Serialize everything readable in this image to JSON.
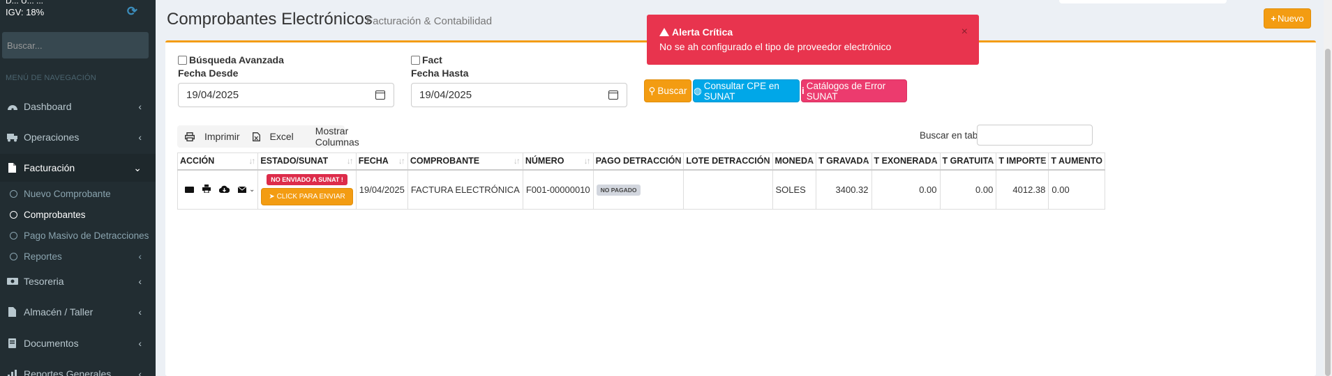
{
  "sidebar": {
    "top_partial": "D... U... ...",
    "igv": "IGV: 18%",
    "search_placeholder": "Buscar...",
    "nav_header": "MENÚ DE NAVEGACIÓN",
    "items": [
      {
        "label": "Dashboard",
        "icon": "dashboard-icon"
      },
      {
        "label": "Operaciones",
        "icon": "truck-icon"
      },
      {
        "label": "Facturación",
        "icon": "file-icon"
      },
      {
        "label": "Tesoreria",
        "icon": "money-icon"
      },
      {
        "label": "Almacén / Taller",
        "icon": "file-icon"
      },
      {
        "label": "Documentos",
        "icon": "book-icon"
      },
      {
        "label": "Reportes Generales",
        "icon": "chart-icon"
      }
    ],
    "submenu": [
      {
        "label": "Nuevo Comprobante"
      },
      {
        "label": "Comprobantes"
      },
      {
        "label": "Pago Masivo de Detracciones"
      },
      {
        "label": "Reportes"
      }
    ]
  },
  "header": {
    "title": "Comprobantes Electrónicos",
    "subtitle": "Facturación & Contabilidad",
    "new_button": "Nuevo"
  },
  "filters": {
    "advanced_search": "Búsqueda Avanzada",
    "second_checkbox": "Fact",
    "date_from_label": "Fecha Desde",
    "date_from_value": "19/04/2025",
    "date_to_label": "Fecha Hasta",
    "date_to_value": "19/04/2025",
    "search_button": "Buscar",
    "consult_button": "Consultar CPE en SUNAT",
    "catalog_button": "Catálogos de Error SUNAT"
  },
  "toolbar": {
    "print": "Imprimir",
    "excel": "Excel",
    "columns": "Mostrar Columnas",
    "table_search_label": "Buscar en tabla:"
  },
  "table": {
    "columns": [
      "ACCIÓN",
      "ESTADO/SUNAT",
      "FECHA",
      "COMPROBANTE",
      "NÚMERO",
      "PAGO DETRACCIÓN",
      "LOTE DETRACCIÓN",
      "MONEDA",
      "T GRAVADA",
      "T EXONERADA",
      "T GRATUITA",
      "T IMPORTE",
      "T AUMENTO"
    ],
    "rows": [
      {
        "estado": "NO ENVIADO A SUNAT !",
        "enviar": "CLICK PARA ENVIAR",
        "fecha": "19/04/2025",
        "comprobante": "FACTURA ELECTRÓNICA",
        "numero": "F001-00000010",
        "pago": "NO PAGADO",
        "lote": "",
        "moneda": "SOLES",
        "gravada": "3400.32",
        "exonerada": "0.00",
        "gratuita": "0.00",
        "importe": "4012.38",
        "aumento": "0.00"
      }
    ]
  },
  "alert": {
    "title": "Alerta Crítica",
    "message": "No se ah configurado el tipo de proveedor electrónico",
    "close": "×"
  },
  "colors": {
    "sidebar_bg": "#222d32",
    "warning": "#f39c12",
    "info": "#00a7e8",
    "danger": "#e8344e",
    "pink": "#ec3b6e"
  }
}
